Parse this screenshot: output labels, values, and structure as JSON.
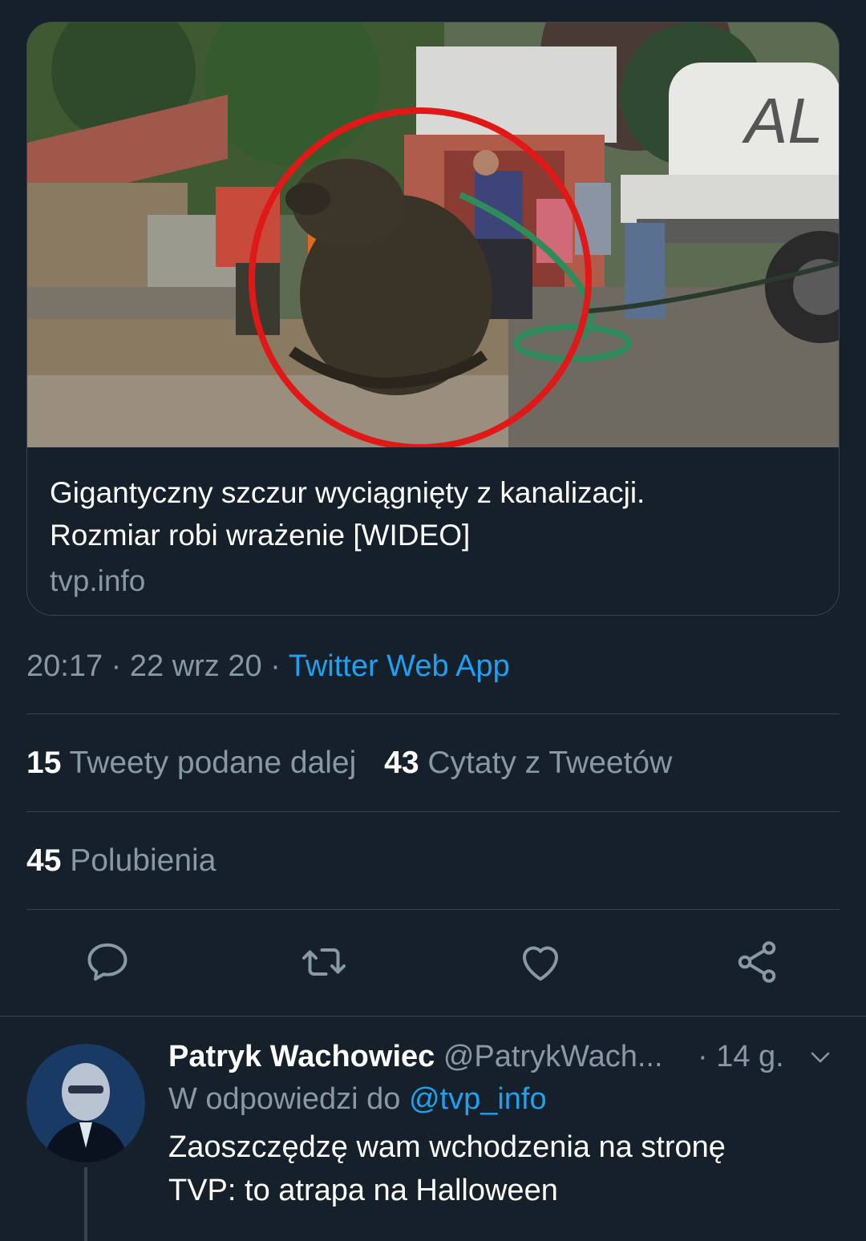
{
  "card": {
    "title_line1": "Gigantyczny szczur wyciągnięty z kanalizacji.",
    "title_line2": "Rozmiar robi wrażenie [WIDEO]",
    "domain": "tvp.info",
    "truck_text": "AL"
  },
  "meta": {
    "time": "20:17",
    "sep1": " · ",
    "date": "22 wrz 20",
    "sep2": " · ",
    "source": "Twitter Web App"
  },
  "stats": {
    "retweets_count": "15",
    "retweets_label": "Tweety podane dalej",
    "quotes_count": "43",
    "quotes_label": "Cytaty z Tweetów",
    "likes_count": "45",
    "likes_label": "Polubienia"
  },
  "actions": [
    "reply-icon",
    "retweet-icon",
    "like-icon",
    "share-icon"
  ],
  "reply": {
    "name": "Patryk Wachowiec",
    "handle": "@PatrykWach...",
    "time": "· 14 g.",
    "reply_prefix": "W odpowiedzi do",
    "reply_mention": "@tvp_info",
    "body_line1": "Zaoszczędzę wam wchodzenia na stronę",
    "body_line2": "TVP: to atrapa na Halloween"
  },
  "colors": {
    "background": "#15202b",
    "border": "#38444d",
    "secondary_text": "#8899a6",
    "accent": "#1da1f2"
  }
}
